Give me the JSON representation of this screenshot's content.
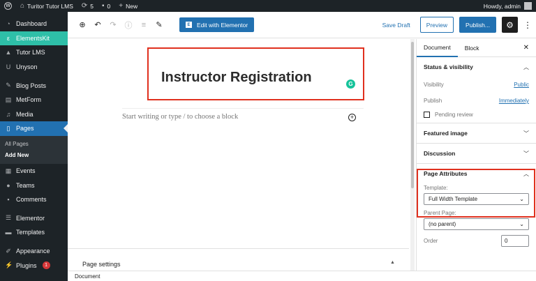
{
  "adminbar": {
    "site_name": "Turitor Tutor LMS",
    "updates_count": "5",
    "comments_count": "0",
    "new_label": "New",
    "howdy": "Howdy, admin"
  },
  "sidebar": {
    "items": [
      {
        "label": "Dashboard",
        "icon": "dashboard-icon"
      },
      {
        "label": "ElementsKit",
        "icon": "elementskit-icon"
      },
      {
        "label": "Tutor LMS",
        "icon": "graduation-cap-icon"
      },
      {
        "label": "Unyson",
        "icon": "unyson-icon"
      },
      {
        "label": "Blog Posts",
        "icon": "pin-icon"
      },
      {
        "label": "MetForm",
        "icon": "form-icon"
      },
      {
        "label": "Media",
        "icon": "media-icon"
      },
      {
        "label": "Pages",
        "icon": "pages-icon"
      },
      {
        "label": "Events",
        "icon": "calendar-icon"
      },
      {
        "label": "Teams",
        "icon": "user-icon"
      },
      {
        "label": "Comments",
        "icon": "comment-icon"
      },
      {
        "label": "Elementor",
        "icon": "elementor-icon"
      },
      {
        "label": "Templates",
        "icon": "folder-icon"
      },
      {
        "label": "Appearance",
        "icon": "brush-icon"
      },
      {
        "label": "Plugins",
        "icon": "plug-icon",
        "badge": "1"
      }
    ],
    "submenu": {
      "all_pages": "All Pages",
      "add_new": "Add New"
    }
  },
  "toolbar": {
    "edit_elementor": "Edit with Elementor",
    "save_draft": "Save Draft",
    "preview": "Preview",
    "publish": "Publish..."
  },
  "editor": {
    "title": "Instructor Registration",
    "block_placeholder": "Start writing or type / to choose a block",
    "page_settings": "Page settings"
  },
  "footer": {
    "breadcrumb": "Document"
  },
  "panel": {
    "tab_document": "Document",
    "tab_block": "Block",
    "status_visibility": {
      "heading": "Status & visibility",
      "visibility_label": "Visibility",
      "visibility_value": "Public",
      "publish_label": "Publish",
      "publish_value": "Immediately",
      "pending_review": "Pending review"
    },
    "featured_image": "Featured image",
    "discussion": "Discussion",
    "page_attributes": {
      "heading": "Page Attributes",
      "template_label": "Template:",
      "template_value": "Full Width Template",
      "parent_label": "Parent Page:",
      "parent_value": "(no parent)",
      "order_label": "Order",
      "order_value": "0"
    }
  },
  "colors": {
    "admin_dark": "#1d2327",
    "accent_blue": "#2271b1",
    "elementskit_teal": "#2ebfa8",
    "highlight_red": "#e0301e"
  }
}
